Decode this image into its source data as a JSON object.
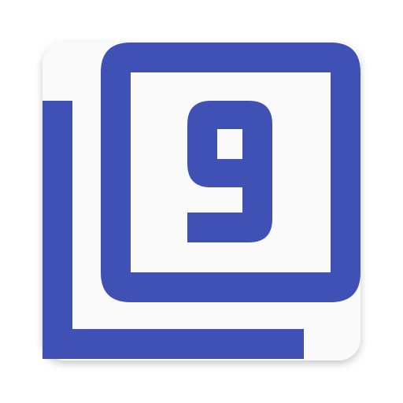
{
  "icon": {
    "name": "filter-nine-icon",
    "digit": "9"
  },
  "colors": {
    "primary": "#3F51B5",
    "tile": "#FAFAFA",
    "background": "#FFFFFF",
    "shadow": "#D9D9D9"
  }
}
